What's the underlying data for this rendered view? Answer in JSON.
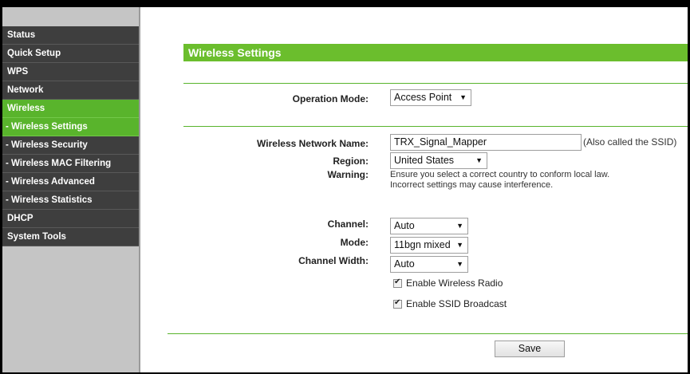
{
  "sidebar": {
    "items": [
      {
        "label": "Status"
      },
      {
        "label": "Quick Setup"
      },
      {
        "label": "WPS"
      },
      {
        "label": "Network"
      },
      {
        "label": "Wireless"
      },
      {
        "label": "- Wireless Settings"
      },
      {
        "label": "- Wireless Security"
      },
      {
        "label": "- Wireless MAC Filtering"
      },
      {
        "label": "- Wireless Advanced"
      },
      {
        "label": "- Wireless Statistics"
      },
      {
        "label": "DHCP"
      },
      {
        "label": "System Tools"
      }
    ]
  },
  "main": {
    "title": "Wireless Settings",
    "operation_mode": {
      "label": "Operation Mode:",
      "value": "Access Point"
    },
    "network_name": {
      "label": "Wireless Network Name:",
      "value": "TRX_Signal_Mapper",
      "note": "(Also called the SSID)"
    },
    "region": {
      "label": "Region:",
      "value": "United States"
    },
    "warning": {
      "label": "Warning:",
      "line1": "Ensure you select a correct country to conform local law.",
      "line2": "Incorrect settings may cause interference."
    },
    "channel": {
      "label": "Channel:",
      "value": "Auto"
    },
    "mode": {
      "label": "Mode:",
      "value": "11bgn mixed"
    },
    "channel_width": {
      "label": "Channel Width:",
      "value": "Auto"
    },
    "enable_radio": {
      "label": "Enable Wireless Radio",
      "checked": true
    },
    "enable_ssid": {
      "label": "Enable SSID Broadcast",
      "checked": true
    },
    "save_label": "Save"
  },
  "colors": {
    "accent_green": "#6bbe2d",
    "nav_dark": "#3e3e3e",
    "nav_active": "#59b42c"
  }
}
